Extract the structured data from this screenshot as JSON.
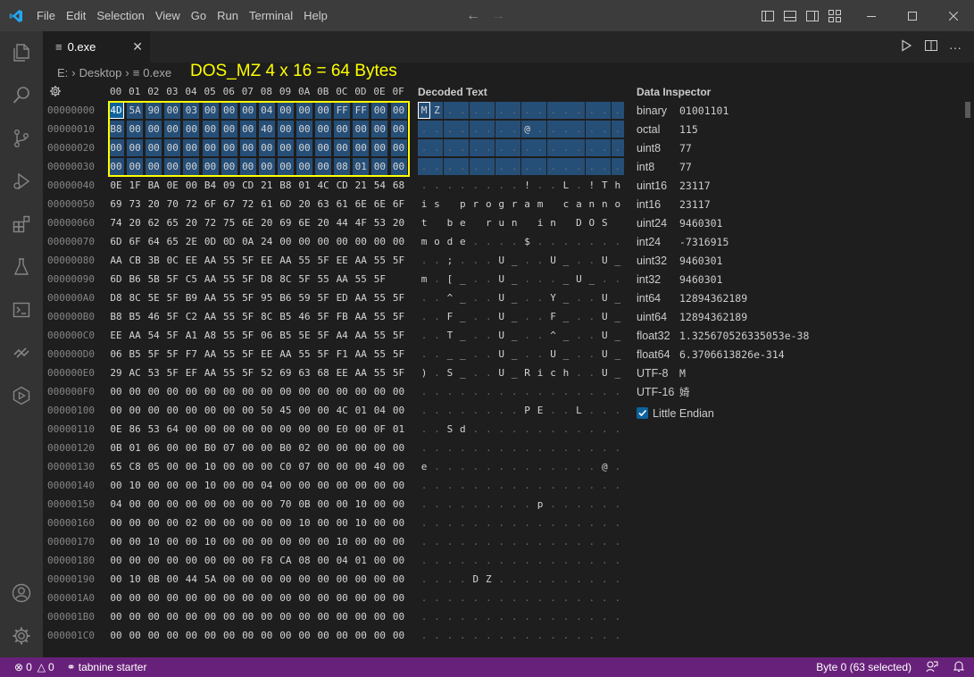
{
  "menu": [
    "File",
    "Edit",
    "Selection",
    "View",
    "Go",
    "Run",
    "Terminal",
    "Help"
  ],
  "tab": {
    "label": "0.exe"
  },
  "breadcrumb": {
    "drive": "E:",
    "folder": "Desktop",
    "file": "0.exe"
  },
  "annotation": "DOS_MZ 4 x 16 = 64 Bytes",
  "columns": [
    "00",
    "01",
    "02",
    "03",
    "04",
    "05",
    "06",
    "07",
    "08",
    "09",
    "0A",
    "0B",
    "0C",
    "0D",
    "0E",
    "0F"
  ],
  "decoded_title": "Decoded Text",
  "inspector_title": "Data Inspector",
  "rows": [
    {
      "offset": "00000000",
      "bytes": "4D 5A 90 00 03 00 00 00 04 00 00 00 FF FF 00 00",
      "text": "MZ.............."
    },
    {
      "offset": "00000010",
      "bytes": "B8 00 00 00 00 00 00 00 40 00 00 00 00 00 00 00",
      "text": "........@......."
    },
    {
      "offset": "00000020",
      "bytes": "00 00 00 00 00 00 00 00 00 00 00 00 00 00 00 00",
      "text": "................"
    },
    {
      "offset": "00000030",
      "bytes": "00 00 00 00 00 00 00 00 00 00 00 00 08 01 00 00",
      "text": "................"
    },
    {
      "offset": "00000040",
      "bytes": "0E 1F BA 0E 00 B4 09 CD 21 B8 01 4C CD 21 54 68",
      "text": "........!..L.!Th"
    },
    {
      "offset": "00000050",
      "bytes": "69 73 20 70 72 6F 67 72 61 6D 20 63 61 6E 6E 6F",
      "text": "is program canno"
    },
    {
      "offset": "00000060",
      "bytes": "74 20 62 65 20 72 75 6E 20 69 6E 20 44 4F 53 20",
      "text": "t be run in DOS "
    },
    {
      "offset": "00000070",
      "bytes": "6D 6F 64 65 2E 0D 0D 0A 24 00 00 00 00 00 00 00",
      "text": "mode....$......."
    },
    {
      "offset": "00000080",
      "bytes": "AA CB 3B 0C EE AA 55 5F EE AA 55 5F EE AA 55 5F",
      "text": "..;...U_..U_..U_"
    },
    {
      "offset": "00000090",
      "bytes": "6D B6 5B 5F C5 AA 55 5F D8 8C 5F 55 AA 55 5F",
      "text": "m.[_..U_..._U_..U_"
    },
    {
      "offset": "000000A0",
      "bytes": "D8 8C 5E 5F B9 AA 55 5F 95 B6 59 5F ED AA 55 5F",
      "text": "..^_..U_..Y_..U_"
    },
    {
      "offset": "000000B0",
      "bytes": "B8 B5 46 5F C2 AA 55 5F 8C B5 46 5F FB AA 55 5F",
      "text": "..F_..U_..F_..U_"
    },
    {
      "offset": "000000C0",
      "bytes": "EE AA 54 5F A1 A8 55 5F 06 B5 5E 5F A4 AA 55 5F",
      "text": "..T_..U_..^_..U_"
    },
    {
      "offset": "000000D0",
      "bytes": "06 B5 5F 5F F7 AA 55 5F EE AA 55 5F F1 AA 55 5F",
      "text": "..__..U_..U_..U_"
    },
    {
      "offset": "000000E0",
      "bytes": "29 AC 53 5F EF AA 55 5F 52 69 63 68 EE AA 55 5F",
      "text": ").S_..U_Rich..U_"
    },
    {
      "offset": "000000F0",
      "bytes": "00 00 00 00 00 00 00 00 00 00 00 00 00 00 00 00",
      "text": "................"
    },
    {
      "offset": "00000100",
      "bytes": "00 00 00 00 00 00 00 00 50 45 00 00 4C 01 04 00",
      "text": "........PE..L..."
    },
    {
      "offset": "00000110",
      "bytes": "0E 86 53 64 00 00 00 00 00 00 00 00 E0 00 0F 01",
      "text": "..Sd............"
    },
    {
      "offset": "00000120",
      "bytes": "0B 01 06 00 00 B0 07 00 00 B0 02 00 00 00 00 00",
      "text": "................"
    },
    {
      "offset": "00000130",
      "bytes": "65 C8 05 00 00 10 00 00 00 C0 07 00 00 00 40 00",
      "text": "e.............@."
    },
    {
      "offset": "00000140",
      "bytes": "00 10 00 00 00 10 00 00 04 00 00 00 00 00 00 00",
      "text": "................"
    },
    {
      "offset": "00000150",
      "bytes": "04 00 00 00 00 00 00 00 00 70 0B 00 00 10 00 00",
      "text": ".........p......"
    },
    {
      "offset": "00000160",
      "bytes": "00 00 00 00 02 00 00 00 00 00 10 00 00 10 00 00",
      "text": "................"
    },
    {
      "offset": "00000170",
      "bytes": "00 00 10 00 00 10 00 00 00 00 00 00 10 00 00 00",
      "text": "................"
    },
    {
      "offset": "00000180",
      "bytes": "00 00 00 00 00 00 00 00 F8 CA 08 00 04 01 00 00",
      "text": "................"
    },
    {
      "offset": "00000190",
      "bytes": "00 10 0B 00 44 5A 00 00 00 00 00 00 00 00 00 00",
      "text": "....DZ.........."
    },
    {
      "offset": "000001A0",
      "bytes": "00 00 00 00 00 00 00 00 00 00 00 00 00 00 00 00",
      "text": "................"
    },
    {
      "offset": "000001B0",
      "bytes": "00 00 00 00 00 00 00 00 00 00 00 00 00 00 00 00",
      "text": "................"
    },
    {
      "offset": "000001C0",
      "bytes": "00 00 00 00 00 00 00 00 00 00 00 00 00 00 00 00",
      "text": "................"
    }
  ],
  "inspector": [
    {
      "label": "binary",
      "value": "01001101"
    },
    {
      "label": "octal",
      "value": "115"
    },
    {
      "label": "uint8",
      "value": "77"
    },
    {
      "label": "int8",
      "value": "77"
    },
    {
      "label": "uint16",
      "value": "23117"
    },
    {
      "label": "int16",
      "value": "23117"
    },
    {
      "label": "uint24",
      "value": "9460301"
    },
    {
      "label": "int24",
      "value": "-7316915"
    },
    {
      "label": "uint32",
      "value": "9460301"
    },
    {
      "label": "int32",
      "value": "9460301"
    },
    {
      "label": "int64",
      "value": "12894362189"
    },
    {
      "label": "uint64",
      "value": "12894362189"
    },
    {
      "label": "float32",
      "value": "1.325670526335053e-38"
    },
    {
      "label": "float64",
      "value": "6.3706613826e-314"
    },
    {
      "label": "UTF-8",
      "value": "M"
    },
    {
      "label": "UTF-16",
      "value": "婍"
    }
  ],
  "little_endian": {
    "label": "Little Endian",
    "checked": true
  },
  "status": {
    "errors": "0",
    "warnings": "0",
    "tabnine": "tabnine starter",
    "selection": "Byte 0 (63 selected)"
  },
  "colors": {
    "statusbar": "#68217a",
    "annotation": "#ffff00",
    "selection": "#264f78"
  }
}
